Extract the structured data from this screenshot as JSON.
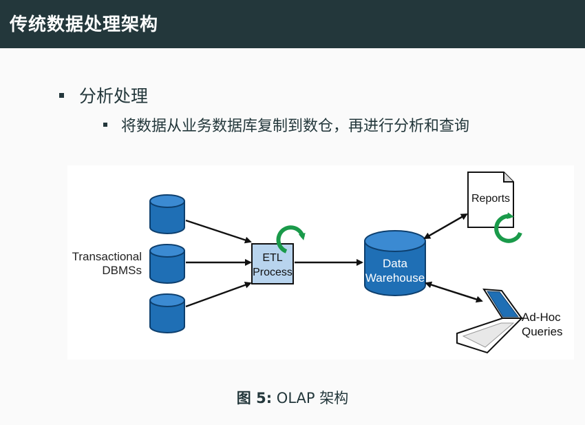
{
  "header": {
    "title": "传统数据处理架构"
  },
  "bullets": {
    "level1": "分析处理",
    "level2": "将数据从业务数据库复制到数仓，再进行分析和查询"
  },
  "diagram": {
    "transactional_label_line1": "Transactional",
    "transactional_label_line2": "DBMSs",
    "etl_line1": "ETL",
    "etl_line2": "Process",
    "dw_line1": "Data",
    "dw_line2": "Warehouse",
    "reports_label": "Reports",
    "adhoc_line1": "Ad-Hoc",
    "adhoc_line2": "Queries"
  },
  "caption": {
    "label": "图 5:",
    "text": "OLAP 架构"
  },
  "colors": {
    "header_bg": "#23373b",
    "db_blue": "#1f6fb5",
    "etl_box": "#b8d4ee",
    "refresh_green": "#1a9a4a"
  },
  "icons": [
    "database-icon",
    "refresh-icon",
    "document-icon",
    "laptop-icon"
  ]
}
